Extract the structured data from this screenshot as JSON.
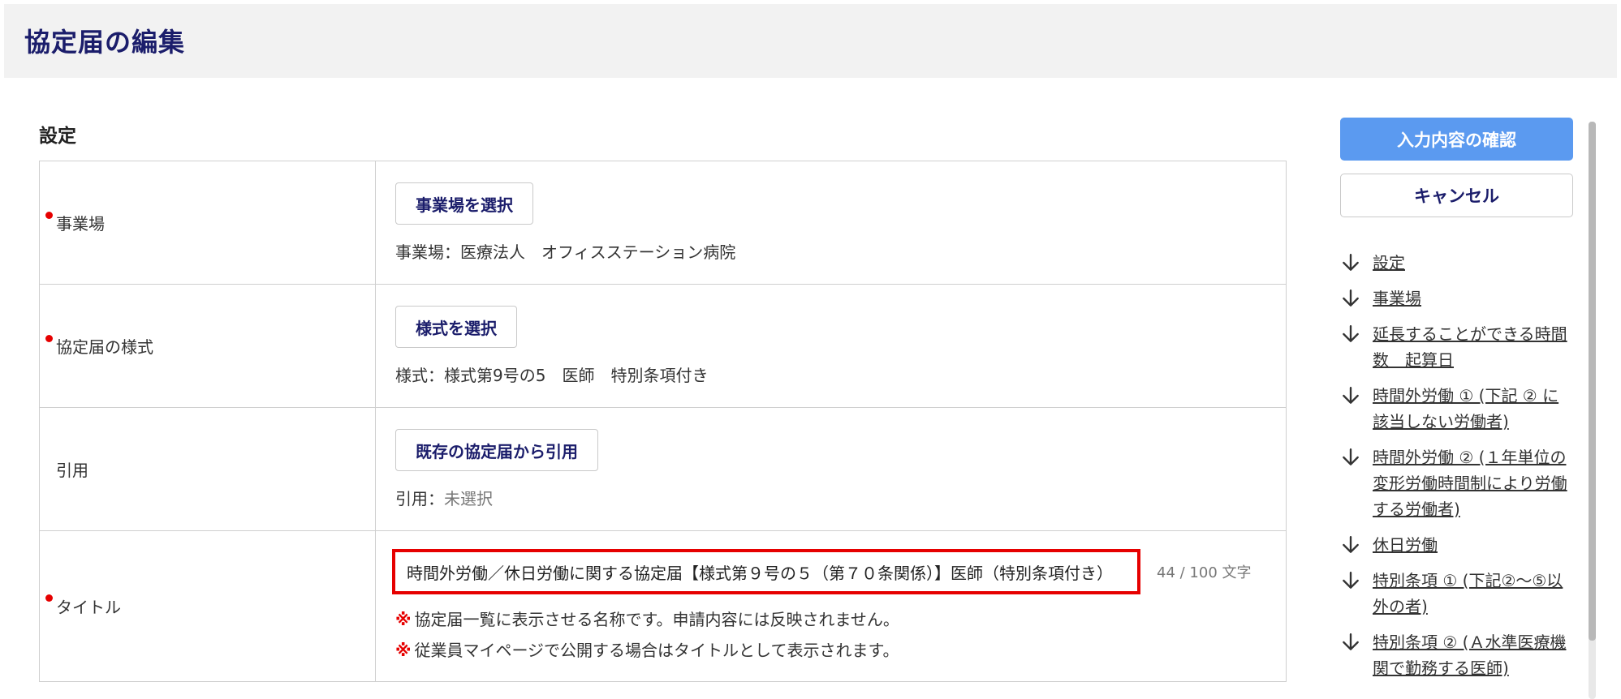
{
  "header": {
    "title": "協定届の編集"
  },
  "section": {
    "title": "設定"
  },
  "rows": {
    "office": {
      "label": "事業場",
      "button": "事業場を選択",
      "value_label": "事業場：",
      "value": "医療法人　オフィスステーション病院"
    },
    "format": {
      "label": "協定届の様式",
      "button": "様式を選択",
      "value_label": "様式：",
      "value": "様式第9号の5　医師　特別条項付き"
    },
    "citation": {
      "label": "引用",
      "button": "既存の協定届から引用",
      "value_label": "引用：",
      "value": "未選択"
    },
    "title": {
      "label": "タイトル",
      "input_value": "時間外労働／休日労働に関する協定届【様式第９号の５（第７０条関係）】医師（特別条項付き）",
      "char_count": "44 / 100 文字",
      "note_mark": "※",
      "note1": "協定届一覧に表示させる名称です。申請内容には反映されません。",
      "note2": "従業員マイページで公開する場合はタイトルとして表示されます。"
    }
  },
  "sidebar": {
    "confirm_button": "入力内容の確認",
    "cancel_button": "キャンセル",
    "anchors": [
      {
        "label": "設定",
        "icon": "arrow-down-icon"
      },
      {
        "label": "事業場",
        "icon": "arrow-down-icon"
      },
      {
        "label": "延長することができる時間数　起算日",
        "icon": "arrow-down-icon"
      },
      {
        "label": "時間外労働 ① (下記 ② に該当しない労働者)",
        "icon": "arrow-down-icon"
      },
      {
        "label": "時間外労働 ② (１年単位の変形労働時間制により労働する労働者)",
        "icon": "arrow-down-icon"
      },
      {
        "label": "休日労働",
        "icon": "arrow-down-icon"
      },
      {
        "label": "特別条項 ① (下記②～⑤以外の者)",
        "icon": "arrow-down-icon"
      },
      {
        "label": "特別条項 ② (Ａ水準医療機関で勤務する医師)",
        "icon": "arrow-down-icon"
      }
    ]
  },
  "colors": {
    "title_navy": "#1b1d6b",
    "required_red": "#e60000",
    "primary_blue": "#5b9af0",
    "header_bg": "#f2f2f2"
  }
}
